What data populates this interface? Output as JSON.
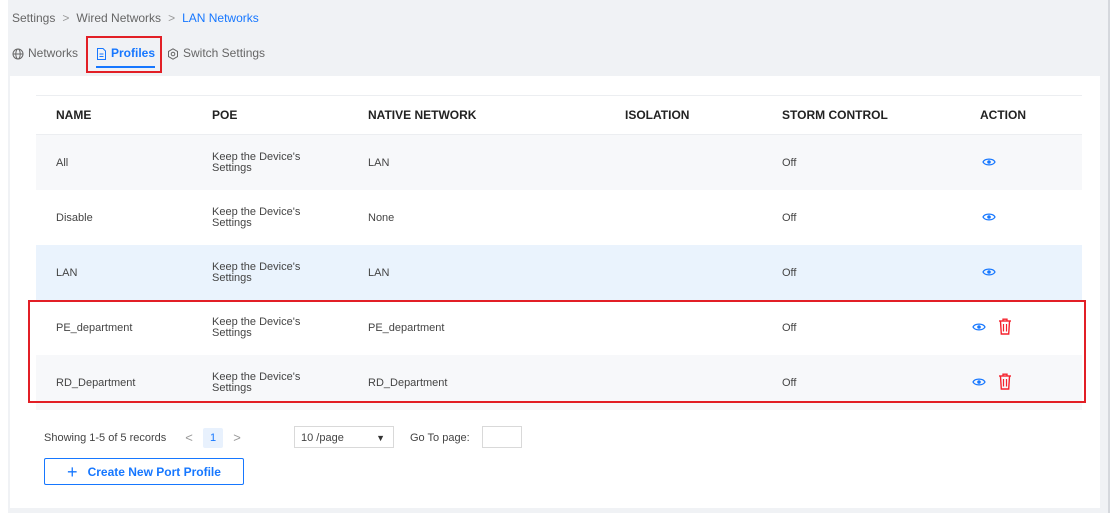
{
  "breadcrumb": {
    "items": [
      "Settings",
      "Wired Networks",
      "LAN Networks"
    ],
    "sep": ">"
  },
  "tabs": [
    {
      "label": "Networks",
      "icon": "globe-icon"
    },
    {
      "label": "Profiles",
      "icon": "document-icon",
      "active": true
    },
    {
      "label": "Switch Settings",
      "icon": "gear-icon"
    }
  ],
  "table": {
    "headers": [
      "NAME",
      "POE",
      "NATIVE NETWORK",
      "ISOLATION",
      "STORM CONTROL",
      "ACTION"
    ],
    "rows": [
      {
        "name": "All",
        "poe_line1": "Keep the Device's",
        "poe_line2": "Settings",
        "native": "LAN",
        "isolation": "",
        "storm": "Off",
        "deletable": false
      },
      {
        "name": "Disable",
        "poe_line1": "Keep the Device's",
        "poe_line2": "Settings",
        "native": "None",
        "isolation": "",
        "storm": "Off",
        "deletable": false
      },
      {
        "name": "LAN",
        "poe_line1": "Keep the Device's",
        "poe_line2": "Settings",
        "native": "LAN",
        "isolation": "",
        "storm": "Off",
        "deletable": false
      },
      {
        "name": "PE_department",
        "poe_line1": "Keep the Device's",
        "poe_line2": "Settings",
        "native": "PE_department",
        "isolation": "",
        "storm": "Off",
        "deletable": true
      },
      {
        "name": "RD_Department",
        "poe_line1": "Keep the Device's",
        "poe_line2": "Settings",
        "native": "RD_Department",
        "isolation": "",
        "storm": "Off",
        "deletable": true
      }
    ]
  },
  "pagination": {
    "summary": "Showing 1-5 of 5 records",
    "prev": "<",
    "current_page": "1",
    "next": ">",
    "page_size": "10 /page",
    "goto_label": "Go To page:",
    "goto_value": ""
  },
  "create_button": {
    "plus": "+",
    "label": "Create New Port Profile"
  },
  "colors": {
    "accent": "#1677ff",
    "danger": "#f5222d",
    "highlight_border": "#e21f26"
  }
}
